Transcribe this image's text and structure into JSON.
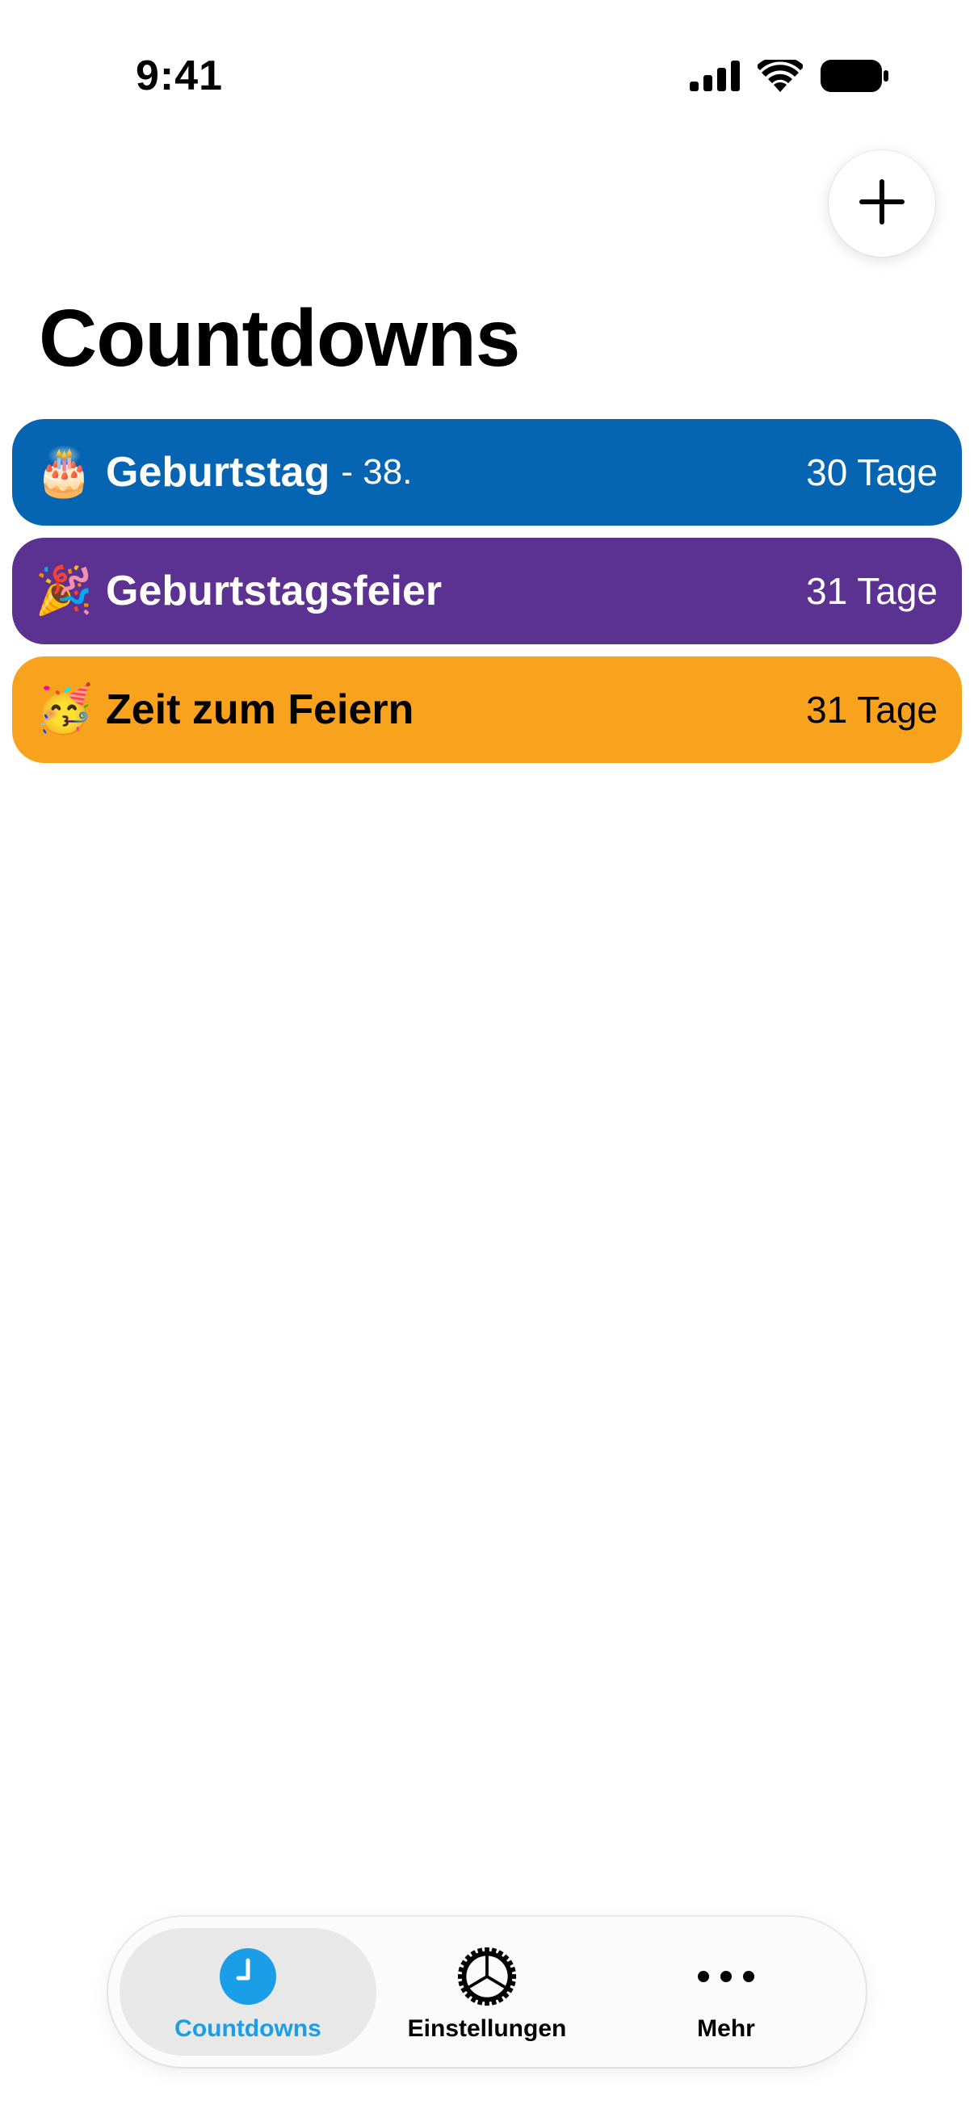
{
  "status_bar": {
    "time": "9:41",
    "icons": [
      "cellular-signal-icon",
      "wifi-icon",
      "battery-icon"
    ]
  },
  "header": {
    "title": "Countdowns",
    "add_icon": "plus-icon"
  },
  "countdowns": [
    {
      "emoji": "🎂",
      "title": "Geburtstag",
      "subtitle": "- 38.",
      "days": "30 Tage",
      "background": "#0565B3",
      "text_color": "#FFFFFF"
    },
    {
      "emoji": "🎉",
      "title": "Geburtstagsfeier",
      "subtitle": "",
      "days": "31 Tage",
      "background": "#5B3192",
      "text_color": "#FFFFFF"
    },
    {
      "emoji": "🥳",
      "title": "Zeit zum Feiern",
      "subtitle": "",
      "days": "31 Tage",
      "background": "#F8A21D",
      "text_color": "#000000"
    }
  ],
  "tab_bar": {
    "tabs": [
      {
        "label": "Countdowns",
        "icon": "clock-icon",
        "active": true,
        "color": "#1A9EE8"
      },
      {
        "label": "Einstellungen",
        "icon": "gear-icon",
        "active": false,
        "color": "#000000"
      },
      {
        "label": "Mehr",
        "icon": "more-icon",
        "active": false,
        "color": "#000000"
      }
    ]
  }
}
